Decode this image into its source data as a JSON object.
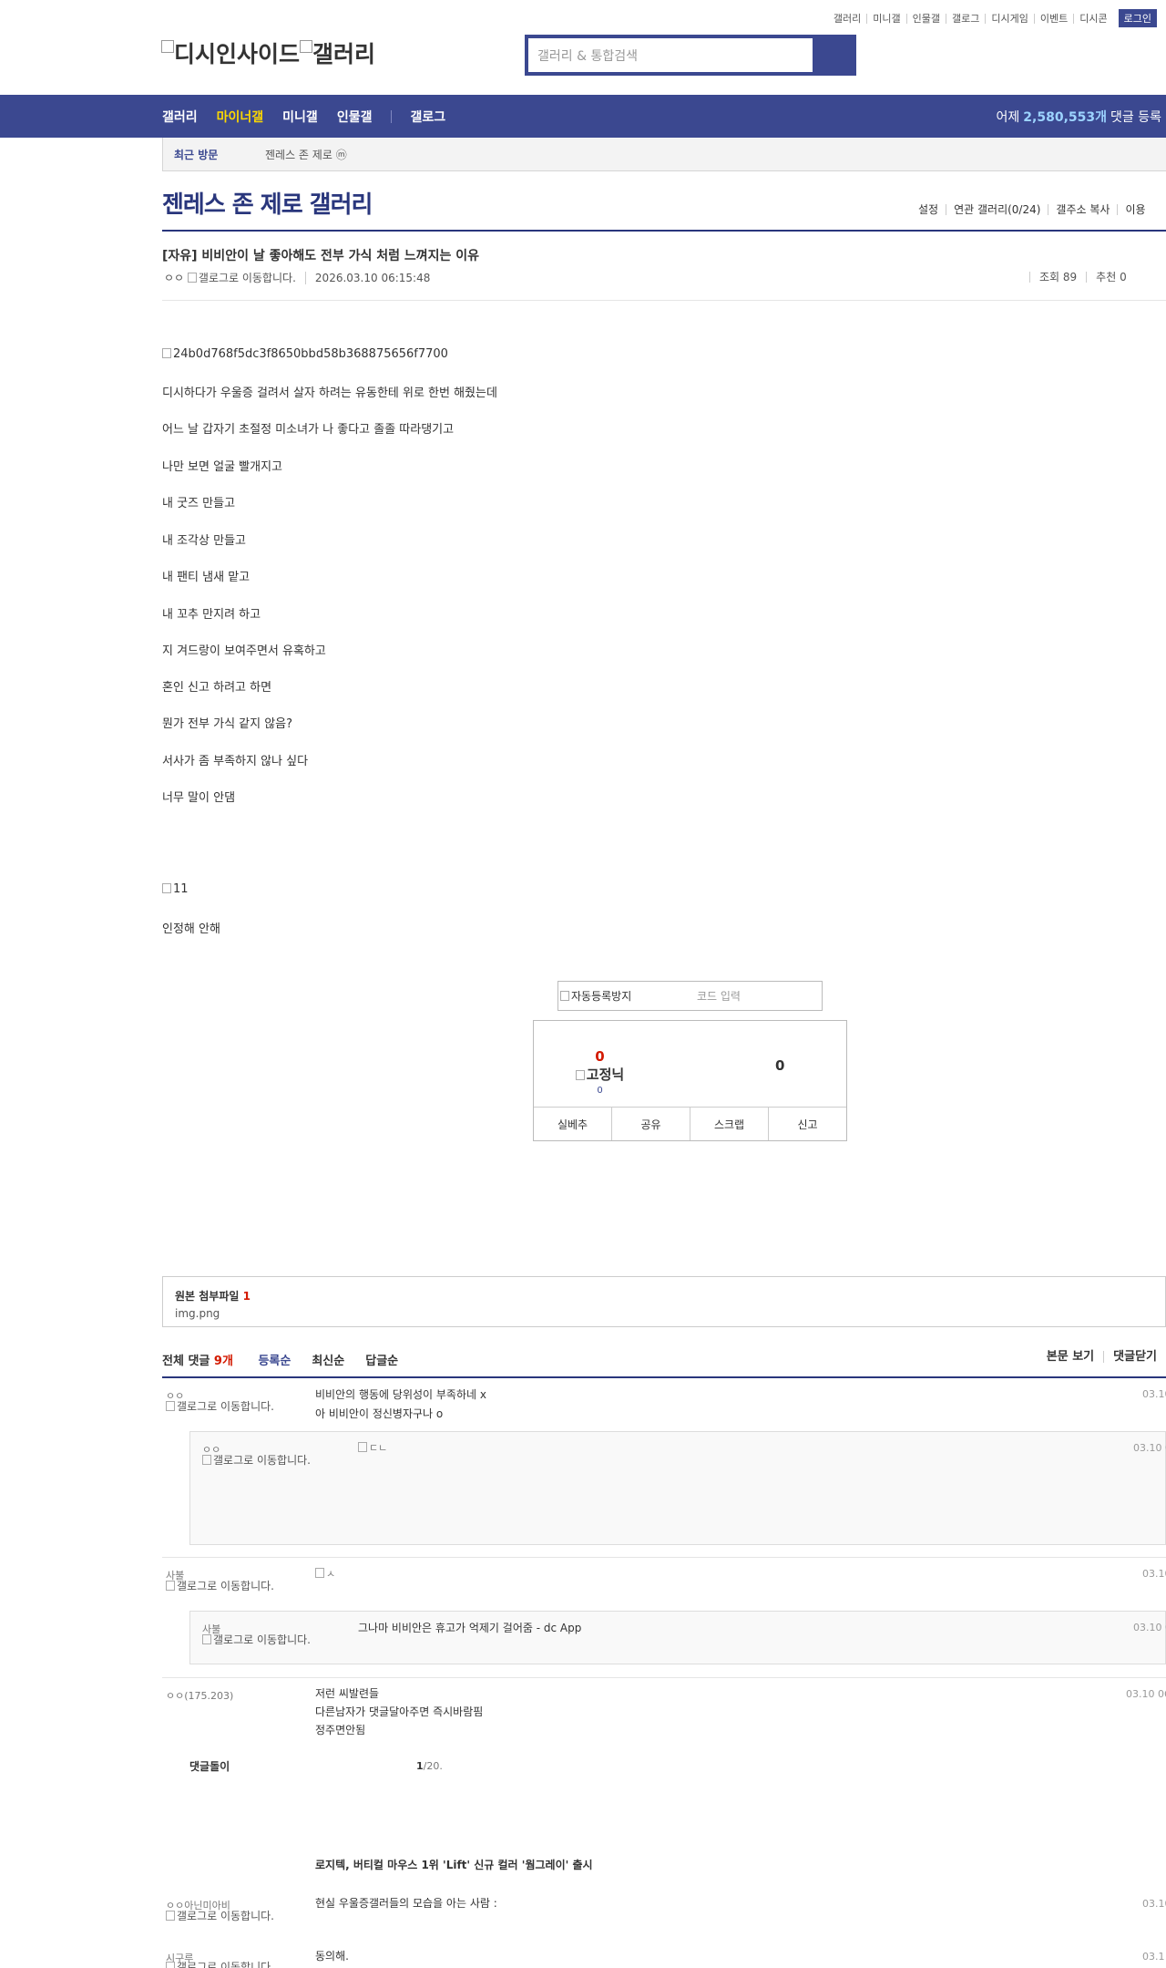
{
  "util_nav": [
    "갤러리",
    "미니갤",
    "인물갤",
    "갤로그",
    "디시게임",
    "이벤트",
    "디시콘"
  ],
  "login_label": "로그인",
  "logo_alt": "디시인사이드",
  "logo_alt2": "갤러리",
  "search": {
    "placeholder": "갤러리 & 통합검색"
  },
  "gnb": {
    "items": [
      "갤러리",
      "마이너갤",
      "미니갤",
      "인물갤",
      "갤로그"
    ],
    "stat_prefix": "어제",
    "stat_value": "2,580,553개",
    "stat_suffix": "댓글 등록"
  },
  "recent": {
    "label": "최근 방문",
    "gallery": "젠레스 존 제로",
    "badge": "ⓜ"
  },
  "gallery_title": "젠레스 존 제로 갤러리",
  "gallery_menu": [
    "설정",
    "연관 갤러리(0/24)",
    "갤주소 복사",
    "이용"
  ],
  "post": {
    "title": "[자유] 비비안이 날 좋아해도 전부 가식 처럼 느껴지는 이유",
    "author": "ㅇㅇ",
    "author_img_alt": "갤로그로 이동합니다.",
    "datetime": "2026.03.10 06:15:48",
    "views": "조회 89",
    "recommend": "추천 0",
    "img1_alt": "24b0d768f5dc3f8650bbd58b368875656f7700",
    "lines": [
      "디시하다가 우울증 걸려서 살자 하려는 유동한테 위로 한번 해줬는데",
      "어느 날 갑자기 초절정 미소녀가 나 좋다고 졸졸 따라댕기고",
      "나만 보면 얼굴 빨개지고",
      "내 굿즈 만들고",
      "내 조각상 만들고",
      "내 팬티 냄새 맡고",
      "내 꼬추 만지려 하고",
      "지 겨드랑이 보여주면서 유혹하고",
      "혼인 신고 하려고 하면",
      "뭔가 전부 가식 같지 않음?",
      "서사가 좀 부족하지 않나 싶다",
      "너무 말이 안댐"
    ],
    "img2_alt": "11",
    "last_line": "인정해 안해"
  },
  "captcha": {
    "img_alt": "자동등록방지",
    "placeholder": "코드 입력"
  },
  "vote": {
    "up_count": "0",
    "up_label": "고정닉",
    "up_sub": "0",
    "down_count": "0",
    "buttons": [
      "실베추",
      "공유",
      "스크랩",
      "신고"
    ]
  },
  "attachment": {
    "title": "원본 첨부파일",
    "count": "1",
    "file": "img.png"
  },
  "comments_bar": {
    "label": "전체 댓글",
    "count": "9개",
    "sorts": [
      "등록순",
      "최신순",
      "답글순"
    ],
    "right": [
      "본문 보기",
      "댓글닫기"
    ]
  },
  "comments": [
    {
      "nick": "ㅇㅇ",
      "img_alt": "갤로그로 이동합니다.",
      "text1": "비비안의 행동에 당위성이 부족하네 x",
      "text2": "아 비비안이 정신병자구나 o",
      "date": "03.10",
      "reply": {
        "nick": "ㅇㅇ",
        "img_alt": "갤로그로 이동합니다.",
        "dccon_alt": "ㄷㄴ",
        "date": "03.10 0"
      }
    },
    {
      "nick": "사불",
      "img_alt": "갤로그로 이동합니다.",
      "dccon_alt": "ㅅ",
      "date": "03.10",
      "reply": {
        "nick": "사불",
        "img_alt": "갤로그로 이동합니다.",
        "text": "그나마 비비안은 휴고가 억제기 걸어줌 - dc App",
        "date": "03.10 0"
      }
    },
    {
      "nick": "ㅇㅇ",
      "ip": "(175.203)",
      "text1": "저런 씨발련들",
      "text2": "다른남자가 댓글달아주면 즉시바람핌",
      "text3": "정주면안됨",
      "date": "03.10 06"
    }
  ],
  "dolls": {
    "label": "댓글돌이",
    "page": "1",
    "total": "/20."
  },
  "ad": "로지텍, 버티컬 마우스 1위 'Lift' 신규 컬러 '웜그레이' 출시",
  "more_comments": [
    {
      "nick": "ㅇㅇ아닌미아비",
      "img_alt": "갤로그로 이동합니다.",
      "text": "현실 우울증갤러들의 모습을 아는 사람 :",
      "date": "03.10"
    },
    {
      "nick": "시구루",
      "img_alt": "갤로그로 이동합니다.",
      "text": "동의해.",
      "date": "03.1"
    }
  ]
}
